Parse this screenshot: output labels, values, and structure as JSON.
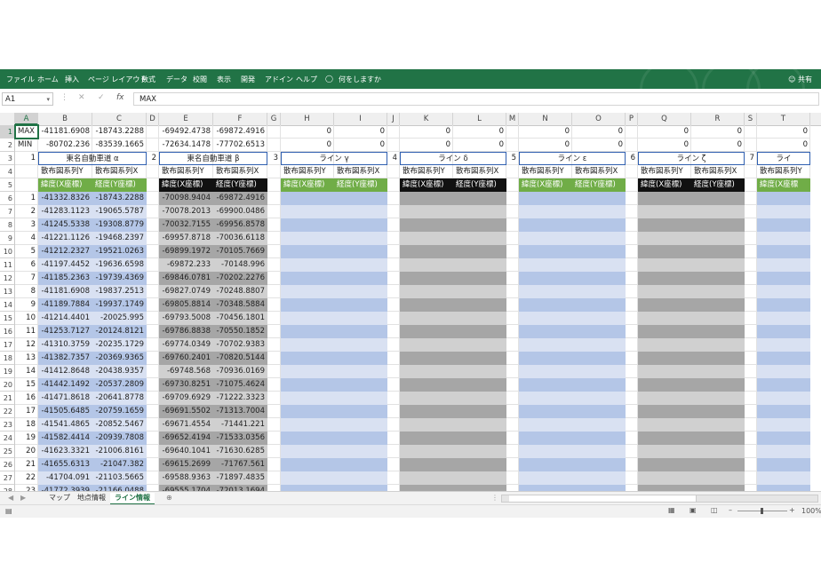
{
  "ribbon": {
    "tabs": [
      "ファイル",
      "ホーム",
      "挿入",
      "ページ レイアウト",
      "数式",
      "データ",
      "校閲",
      "表示",
      "開発",
      "アドイン",
      "ヘルプ",
      "何をしますか"
    ],
    "share": "共有",
    "color": "#217346"
  },
  "formula_bar": {
    "name_box": "A1",
    "fx": "fx",
    "content": "MAX"
  },
  "columns": [
    "A",
    "B",
    "C",
    "D",
    "E",
    "F",
    "G",
    "H",
    "I",
    "J",
    "K",
    "L",
    "M",
    "N",
    "O",
    "P",
    "Q",
    "R",
    "S",
    "T"
  ],
  "row_numbers": [
    "1",
    "2",
    "3",
    "4",
    "5",
    "6",
    "7",
    "8",
    "9",
    "10",
    "11",
    "12",
    "13",
    "14",
    "15",
    "16",
    "17",
    "18",
    "19",
    "20",
    "21",
    "22",
    "23",
    "24",
    "25",
    "26",
    "27",
    "28"
  ],
  "sheet": {
    "row1_label": "MAX",
    "row2_label": "MIN",
    "max": {
      "B": "-41181.6908",
      "C": "-18743.2288",
      "E": "-69492.4738",
      "F": "-69872.4916"
    },
    "min": {
      "B": "-80702.236",
      "C": "-83539.1665",
      "E": "-72634.1478",
      "F": "-77702.6513"
    },
    "zero": "0",
    "groups": [
      {
        "num": "1",
        "name": "東名自動車道 α",
        "sub_y": "散布図系列Y",
        "sub_x": "散布図系列X",
        "h_lat": "緯度(X座標)",
        "h_lon": "経度(Y座標)"
      },
      {
        "num": "2",
        "name": "東名自動車道 β",
        "sub_y": "散布図系列Y",
        "sub_x": "散布図系列X",
        "h_lat": "緯度(X座標)",
        "h_lon": "経度(Y座標)"
      },
      {
        "num": "3",
        "name": "ライン γ",
        "sub_y": "散布図系列Y",
        "sub_x": "散布図系列X",
        "h_lat": "緯度(X座標)",
        "h_lon": "経度(Y座標)"
      },
      {
        "num": "4",
        "name": "ライン δ",
        "sub_y": "散布図系列Y",
        "sub_x": "散布図系列X",
        "h_lat": "緯度(X座標)",
        "h_lon": "経度(Y座標)"
      },
      {
        "num": "5",
        "name": "ライン ε",
        "sub_y": "散布図系列Y",
        "sub_x": "散布図系列X",
        "h_lat": "緯度(X座標)",
        "h_lon": "経度(Y座標)"
      },
      {
        "num": "6",
        "name": "ライン ζ",
        "sub_y": "散布図系列Y",
        "sub_x": "散布図系列X",
        "h_lat": "緯度(X座標)",
        "h_lon": "経度(Y座標)"
      },
      {
        "num": "7",
        "name": "ライ",
        "sub_y": "散布図系列Y",
        "sub_x": "",
        "h_lat": "緯度(X座標",
        "h_lon": ""
      }
    ],
    "rows": [
      [
        "1",
        "-41332.8326",
        "-18743.2288",
        "-70098.9404",
        "-69872.4916"
      ],
      [
        "2",
        "-41283.1123",
        "-19065.5787",
        "-70078.2013",
        "-69900.0486"
      ],
      [
        "3",
        "-41245.5338",
        "-19308.8779",
        "-70032.7155",
        "-69956.8578"
      ],
      [
        "4",
        "-41221.1126",
        "-19468.2397",
        "-69957.8718",
        "-70036.6118"
      ],
      [
        "5",
        "-41212.2327",
        "-19521.0263",
        "-69899.1972",
        "-70105.7669"
      ],
      [
        "6",
        "-41197.4452",
        "-19636.6598",
        "-69872.233",
        "-70148.996"
      ],
      [
        "7",
        "-41185.2363",
        "-19739.4369",
        "-69846.0781",
        "-70202.2276"
      ],
      [
        "8",
        "-41181.6908",
        "-19837.2513",
        "-69827.0749",
        "-70248.8807"
      ],
      [
        "9",
        "-41189.7884",
        "-19937.1749",
        "-69805.8814",
        "-70348.5884"
      ],
      [
        "10",
        "-41214.4401",
        "-20025.995",
        "-69793.5008",
        "-70456.1801"
      ],
      [
        "11",
        "-41253.7127",
        "-20124.8121",
        "-69786.8838",
        "-70550.1852"
      ],
      [
        "12",
        "-41310.3759",
        "-20235.1729",
        "-69774.0349",
        "-70702.9383"
      ],
      [
        "13",
        "-41382.7357",
        "-20369.9365",
        "-69760.2401",
        "-70820.5144"
      ],
      [
        "14",
        "-41412.8648",
        "-20438.9357",
        "-69748.568",
        "-70936.0169"
      ],
      [
        "15",
        "-41442.1492",
        "-20537.2809",
        "-69730.8251",
        "-71075.4624"
      ],
      [
        "16",
        "-41471.8618",
        "-20641.8778",
        "-69709.6929",
        "-71222.3323"
      ],
      [
        "17",
        "-41505.6485",
        "-20759.1659",
        "-69691.5502",
        "-71313.7004"
      ],
      [
        "18",
        "-41541.4865",
        "-20852.5467",
        "-69671.4554",
        "-71441.221"
      ],
      [
        "19",
        "-41582.4414",
        "-20939.7808",
        "-69652.4194",
        "-71533.0356"
      ],
      [
        "20",
        "-41623.3321",
        "-21006.8161",
        "-69640.1041",
        "-71630.6285"
      ],
      [
        "21",
        "-41655.6313",
        "-21047.382",
        "-69615.2699",
        "-71767.561"
      ],
      [
        "22",
        "-41704.091",
        "-21103.5665",
        "-69588.9363",
        "-71897.4835"
      ],
      [
        "23",
        "-41772.3939",
        "-21166.0488",
        "-69555.1704",
        "-72013.1694"
      ]
    ]
  },
  "sheet_tabs": [
    "マップ",
    "地点情報",
    "ライン情報"
  ],
  "status": {
    "zoom": "100%"
  }
}
